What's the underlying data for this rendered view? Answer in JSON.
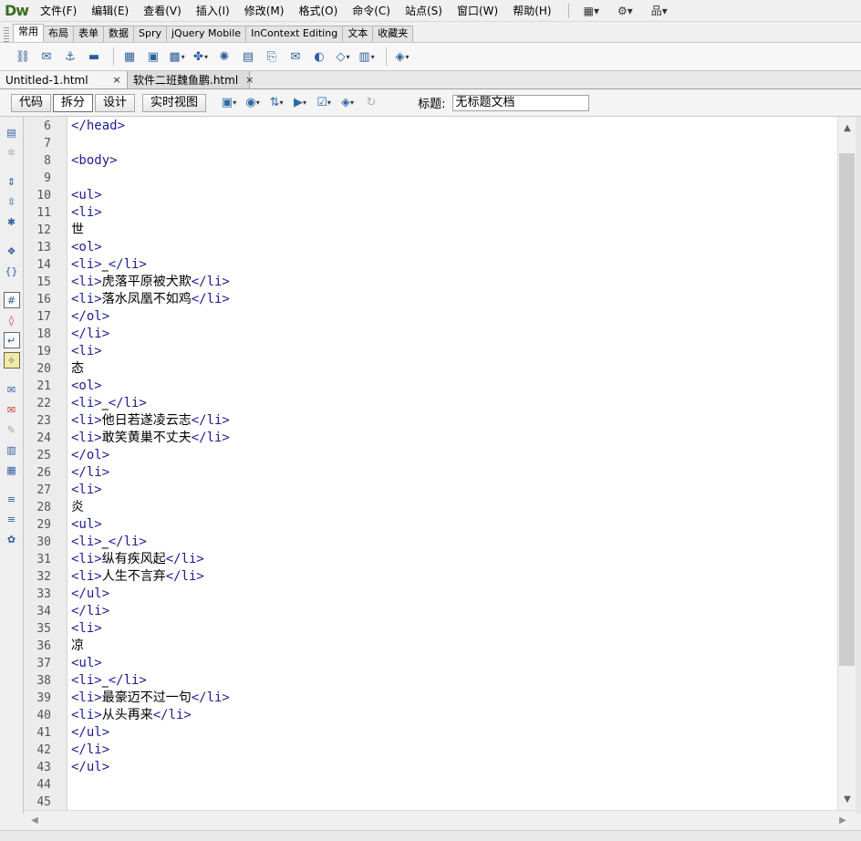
{
  "app": {
    "logo": "Dw"
  },
  "menu": {
    "items": [
      "文件(F)",
      "编辑(E)",
      "查看(V)",
      "插入(I)",
      "修改(M)",
      "格式(O)",
      "命令(C)",
      "站点(S)",
      "窗口(W)",
      "帮助(H)"
    ],
    "tools": [
      "▦▾",
      "⚙▾",
      "品▾"
    ]
  },
  "insert_tabs": [
    "常用",
    "布局",
    "表单",
    "数据",
    "Spry",
    "jQuery Mobile",
    "InContext Editing",
    "文本",
    "收藏夹"
  ],
  "insert_toolbar_icons": [
    "hyperlink-icon",
    "email-link-icon",
    "named-anchor-icon",
    "horizontal-rule-icon",
    "table-icon",
    "insert-div-icon",
    "images-icon",
    "media-icon",
    "widget-icon",
    "date-icon",
    "server-side-include-icon",
    "comment-icon",
    "head-icon",
    "script-icon",
    "templates-icon",
    "tag-chooser-icon"
  ],
  "doc_tabs": [
    {
      "label": "Untitled-1.html",
      "close": "×"
    },
    {
      "label": "软件二班魏鱼鹏.html",
      "close": "×"
    }
  ],
  "doc_toolbar": {
    "views": [
      "代码",
      "拆分",
      "设计",
      "实时视图"
    ],
    "active_view": "拆分",
    "title_label": "标题:",
    "title_value": "无标题文档"
  },
  "editor": {
    "lines": [
      {
        "n": "6",
        "segs": [
          {
            "t": "</head>",
            "k": "tag"
          }
        ]
      },
      {
        "n": "7",
        "segs": []
      },
      {
        "n": "8",
        "segs": [
          {
            "t": "<body>",
            "k": "tag"
          }
        ]
      },
      {
        "n": "9",
        "segs": []
      },
      {
        "n": "10",
        "segs": [
          {
            "t": "<ul>",
            "k": "tag"
          }
        ]
      },
      {
        "n": "11",
        "segs": [
          {
            "t": "<li>",
            "k": "tag"
          }
        ]
      },
      {
        "n": "12",
        "segs": [
          {
            "t": "世",
            "k": "txt"
          }
        ]
      },
      {
        "n": "13",
        "segs": [
          {
            "t": "<ol>",
            "k": "tag"
          }
        ]
      },
      {
        "n": "14",
        "segs": [
          {
            "t": "<li>",
            "k": "tag"
          },
          {
            "t": "_",
            "k": "txt"
          },
          {
            "t": "</li>",
            "k": "tag"
          }
        ]
      },
      {
        "n": "15",
        "segs": [
          {
            "t": "<li>",
            "k": "tag"
          },
          {
            "t": "虎落平原被犬欺",
            "k": "txt"
          },
          {
            "t": "</li>",
            "k": "tag"
          }
        ]
      },
      {
        "n": "16",
        "segs": [
          {
            "t": "<li>",
            "k": "tag"
          },
          {
            "t": "落水凤凰不如鸡",
            "k": "txt"
          },
          {
            "t": "</li>",
            "k": "tag"
          }
        ]
      },
      {
        "n": "17",
        "segs": [
          {
            "t": "</ol>",
            "k": "tag"
          }
        ]
      },
      {
        "n": "18",
        "segs": [
          {
            "t": "</li>",
            "k": "tag"
          }
        ]
      },
      {
        "n": "19",
        "segs": [
          {
            "t": "<li>",
            "k": "tag"
          }
        ]
      },
      {
        "n": "20",
        "segs": [
          {
            "t": "态",
            "k": "txt"
          }
        ]
      },
      {
        "n": "21",
        "segs": [
          {
            "t": "<ol>",
            "k": "tag"
          }
        ]
      },
      {
        "n": "22",
        "segs": [
          {
            "t": "<li>",
            "k": "tag"
          },
          {
            "t": "_",
            "k": "txt"
          },
          {
            "t": "</li>",
            "k": "tag"
          }
        ]
      },
      {
        "n": "23",
        "segs": [
          {
            "t": "<li>",
            "k": "tag"
          },
          {
            "t": "他日若遂凌云志",
            "k": "txt"
          },
          {
            "t": "</li>",
            "k": "tag"
          }
        ]
      },
      {
        "n": "24",
        "segs": [
          {
            "t": "<li>",
            "k": "tag"
          },
          {
            "t": "敢笑黄巢不丈夫",
            "k": "txt"
          },
          {
            "t": "</li>",
            "k": "tag"
          }
        ]
      },
      {
        "n": "25",
        "segs": [
          {
            "t": "</ol>",
            "k": "tag"
          }
        ]
      },
      {
        "n": "26",
        "segs": [
          {
            "t": "</li>",
            "k": "tag"
          }
        ]
      },
      {
        "n": "27",
        "segs": [
          {
            "t": "<li>",
            "k": "tag"
          }
        ]
      },
      {
        "n": "28",
        "segs": [
          {
            "t": "炎",
            "k": "txt"
          }
        ]
      },
      {
        "n": "29",
        "segs": [
          {
            "t": "<ul>",
            "k": "tag"
          }
        ]
      },
      {
        "n": "30",
        "segs": [
          {
            "t": "<li>",
            "k": "tag"
          },
          {
            "t": "_",
            "k": "txt"
          },
          {
            "t": "</li>",
            "k": "tag"
          }
        ]
      },
      {
        "n": "31",
        "segs": [
          {
            "t": "<li>",
            "k": "tag"
          },
          {
            "t": "纵有疾风起",
            "k": "txt"
          },
          {
            "t": "</li>",
            "k": "tag"
          }
        ]
      },
      {
        "n": "32",
        "segs": [
          {
            "t": "<li>",
            "k": "tag"
          },
          {
            "t": "人生不言弃",
            "k": "txt"
          },
          {
            "t": "</li>",
            "k": "tag"
          }
        ]
      },
      {
        "n": "33",
        "segs": [
          {
            "t": "</ul>",
            "k": "tag"
          }
        ]
      },
      {
        "n": "34",
        "segs": [
          {
            "t": "</li>",
            "k": "tag"
          }
        ]
      },
      {
        "n": "35",
        "segs": [
          {
            "t": "<li>",
            "k": "tag"
          }
        ]
      },
      {
        "n": "36",
        "segs": [
          {
            "t": "凉",
            "k": "txt"
          }
        ]
      },
      {
        "n": "37",
        "segs": [
          {
            "t": "<ul>",
            "k": "tag"
          }
        ]
      },
      {
        "n": "38",
        "segs": [
          {
            "t": "<li>",
            "k": "tag"
          },
          {
            "t": "_",
            "k": "txt"
          },
          {
            "t": "</li>",
            "k": "tag"
          }
        ]
      },
      {
        "n": "39",
        "segs": [
          {
            "t": "<li>",
            "k": "tag"
          },
          {
            "t": "最豪迈不过一句",
            "k": "txt"
          },
          {
            "t": "</li>",
            "k": "tag"
          }
        ]
      },
      {
        "n": "40",
        "segs": [
          {
            "t": "<li>",
            "k": "tag"
          },
          {
            "t": "从头再来",
            "k": "txt"
          },
          {
            "t": "</li>",
            "k": "tag"
          }
        ]
      },
      {
        "n": "41",
        "segs": [
          {
            "t": "</ul>",
            "k": "tag"
          }
        ]
      },
      {
        "n": "42",
        "segs": [
          {
            "t": "</li>",
            "k": "tag"
          }
        ]
      },
      {
        "n": "43",
        "segs": [
          {
            "t": "</ul>",
            "k": "tag"
          }
        ]
      },
      {
        "n": "44",
        "segs": []
      },
      {
        "n": "45",
        "segs": []
      }
    ]
  },
  "scroll": {
    "up": "▲",
    "down": "▼",
    "left": "◀",
    "right": "▶",
    "position": 0.12
  },
  "colors": {
    "tag": "#1d1d8f",
    "text": "#000000",
    "gutter": "#ececec",
    "logo": "#3b6d1f"
  }
}
